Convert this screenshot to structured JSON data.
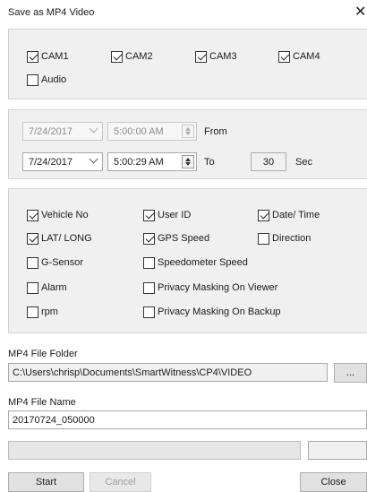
{
  "window": {
    "title": "Save as MP4 Video",
    "close_glyph": "✕"
  },
  "channels": {
    "cam1": {
      "label": "CAM1",
      "checked": true
    },
    "cam2": {
      "label": "CAM2",
      "checked": true
    },
    "cam3": {
      "label": "CAM3",
      "checked": true
    },
    "cam4": {
      "label": "CAM4",
      "checked": true
    },
    "audio": {
      "label": "Audio",
      "checked": false
    }
  },
  "time_range": {
    "from_date": "7/24/2017",
    "from_time": "5:00:00 AM",
    "from_label": "From",
    "to_date": "7/24/2017",
    "to_time": "5:00:29 AM",
    "to_label": "To",
    "duration": "30",
    "duration_unit": "Sec"
  },
  "overlays": {
    "vehicle_no": {
      "label": "Vehicle No",
      "checked": true
    },
    "user_id": {
      "label": "User ID",
      "checked": true
    },
    "date_time": {
      "label": "Date/ Time",
      "checked": true
    },
    "lat_long": {
      "label": "LAT/ LONG",
      "checked": true
    },
    "gps_speed": {
      "label": "GPS Speed",
      "checked": true
    },
    "direction": {
      "label": "Direction",
      "checked": false
    },
    "g_sensor": {
      "label": "G-Sensor",
      "checked": false
    },
    "speedometer_speed": {
      "label": "Speedometer Speed",
      "checked": false
    },
    "alarm": {
      "label": "Alarm",
      "checked": false
    },
    "privacy_viewer": {
      "label": "Privacy Masking On Viewer",
      "checked": false
    },
    "rpm": {
      "label": "rpm",
      "checked": false
    },
    "privacy_backup": {
      "label": "Privacy Masking On Backup",
      "checked": false
    }
  },
  "output": {
    "folder_label": "MP4 File Folder",
    "folder_path": "C:\\Users\\chrisp\\Documents\\SmartWitness\\CP4\\VIDEO",
    "browse_label": "...",
    "name_label": "MP4 File Name",
    "file_name": "20170724_050000",
    "progress": 0,
    "status": ""
  },
  "actions": {
    "start": "Start",
    "cancel": "Cancel",
    "close": "Close"
  },
  "colors": {
    "panel": "#f0f0f0",
    "button": "#e1e1e1",
    "progress_fill": "#06b025"
  }
}
